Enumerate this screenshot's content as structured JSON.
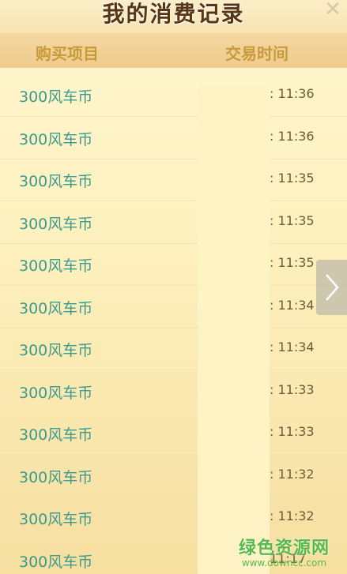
{
  "header": {
    "title": "我的消费记录",
    "close_icon": "close-icon"
  },
  "columns": {
    "item": "购买项目",
    "time": "交易时间"
  },
  "rows": [
    {
      "item": "300风车币",
      "time": ": 11:36"
    },
    {
      "item": "300风车币",
      "time": ": 11:36"
    },
    {
      "item": "300风车币",
      "time": ": 11:35"
    },
    {
      "item": "300风车币",
      "time": ": 11:35"
    },
    {
      "item": "300风车币",
      "time": ": 11:35"
    },
    {
      "item": "300风车币",
      "time": ": 11:34"
    },
    {
      "item": "300风车币",
      "time": ": 11:34"
    },
    {
      "item": "300风车币",
      "time": ": 11:33"
    },
    {
      "item": "300风车币",
      "time": ": 11:33"
    },
    {
      "item": "300风车币",
      "time": ": 11:32"
    },
    {
      "item": "300风车币",
      "time": ": 11:32"
    },
    {
      "item": "300风车币",
      "time": "11:17"
    }
  ],
  "next_icon": "chevron-right-icon",
  "watermark": {
    "main": "绿色资源网",
    "sub": "www.downcc.com"
  },
  "colors": {
    "item_text": "#3c9a8f",
    "header_text": "#c79a3a",
    "watermark": "#59b94a"
  }
}
